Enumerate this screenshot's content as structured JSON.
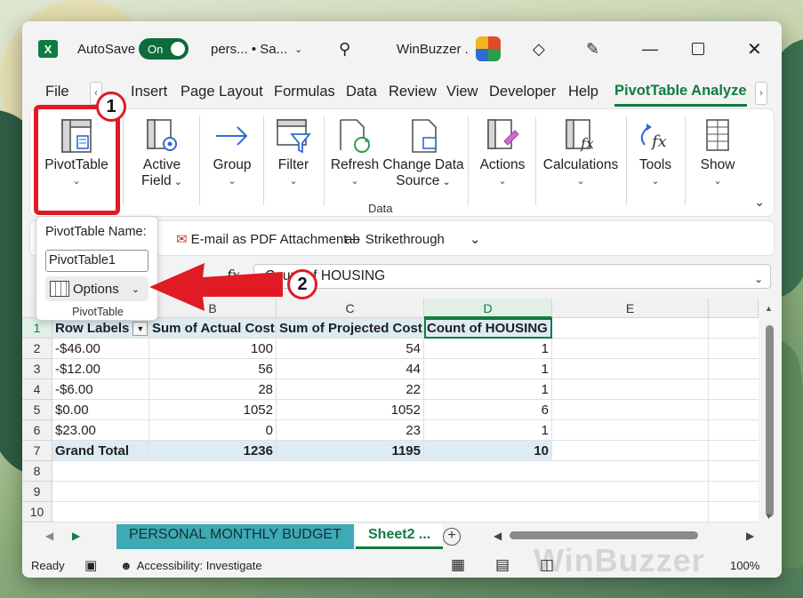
{
  "titlebar": {
    "app_icon": "excel-icon",
    "autosave_label": "AutoSave",
    "autosave_state": "On",
    "filename": "pers...  • Sa...",
    "account_name": "WinBuzzer ."
  },
  "menu_tabs": [
    "File",
    "Insert",
    "Page Layout",
    "Formulas",
    "Data",
    "Review",
    "View",
    "Developer",
    "Help",
    "PivotTable Analyze"
  ],
  "ribbon": {
    "pivottable": "PivotTable",
    "active_field_1": "Active",
    "active_field_2": "Field",
    "group": "Group",
    "filter": "Filter",
    "refresh": "Refresh",
    "change_data_source_1": "Change Data",
    "change_data_source_2": "Source",
    "data_group_label": "Data",
    "actions": "Actions",
    "calculations": "Calculations",
    "tools": "Tools",
    "show": "Show"
  },
  "qat": {
    "email_pdf": "E-mail as PDF Attachment",
    "strike": "Strikethrough",
    "strike_icon_text": "ab"
  },
  "dropdown": {
    "name_label": "PivotTable Name:",
    "name_value": "PivotTable1",
    "options_label": "Options",
    "group_label": "PivotTable"
  },
  "formula_bar": {
    "fx": "fx",
    "content": "Count of HOUSING"
  },
  "annotations": {
    "badge1": "1",
    "badge2": "2"
  },
  "columns": [
    "B",
    "C",
    "D",
    "E"
  ],
  "rows": [
    "1",
    "2",
    "3",
    "4",
    "5",
    "6",
    "7",
    "8",
    "9",
    "10"
  ],
  "table": {
    "headers": [
      "Row Labels",
      "Sum of Actual Cost",
      "Sum of Projected Cost",
      "Count of HOUSING"
    ],
    "data": [
      [
        "-$46.00",
        "100",
        "54",
        "1"
      ],
      [
        "-$12.00",
        "56",
        "44",
        "1"
      ],
      [
        "-$6.00",
        "28",
        "22",
        "1"
      ],
      [
        "$0.00",
        "1052",
        "1052",
        "6"
      ],
      [
        "$23.00",
        "0",
        "23",
        "1"
      ]
    ],
    "total": [
      "Grand Total",
      "1236",
      "1195",
      "10"
    ]
  },
  "sheets": {
    "tab1": "PERSONAL MONTHLY BUDGET",
    "tab2": "Sheet2 ..."
  },
  "status": {
    "ready": "Ready",
    "accessibility": "Accessibility: Investigate",
    "zoom": "100%"
  },
  "watermark": "WinBuzzer",
  "colors": {
    "excel_green": "#107c41",
    "annotation_red": "#e01b24",
    "pivot_tint": "#ddebf4",
    "sheet_tab_teal": "#3fa9b5"
  }
}
